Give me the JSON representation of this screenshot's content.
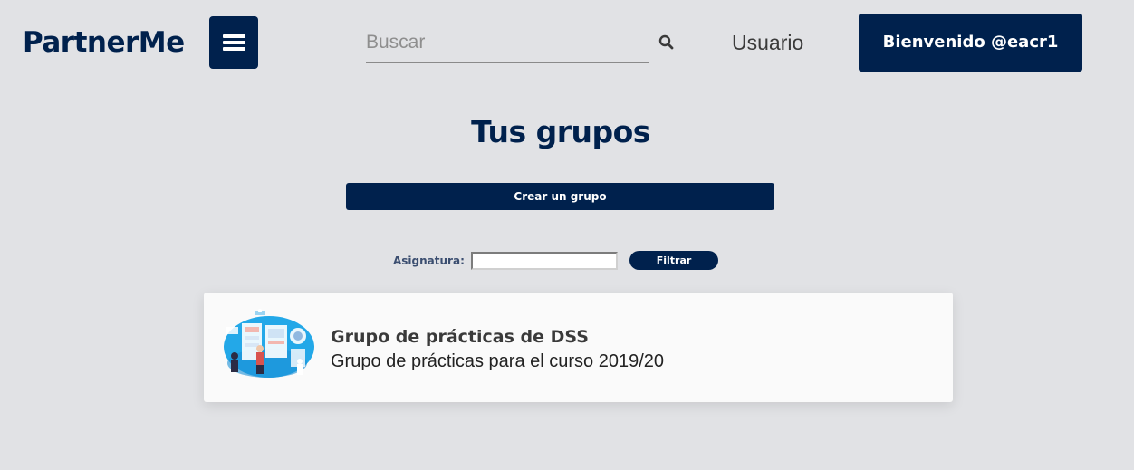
{
  "header": {
    "brand": "PartnerMe",
    "search": {
      "placeholder": "Buscar",
      "value": ""
    },
    "user_link": "Usuario",
    "welcome_button": "Bienvenido @eacr1"
  },
  "main": {
    "title": "Tus grupos",
    "create_button": "Crear un grupo",
    "filter": {
      "label": "Asignatura:",
      "value": "",
      "button": "Filtrar"
    },
    "groups": [
      {
        "name": "Grupo de prácticas de DSS",
        "description": "Grupo de prácticas para el curso 2019/20",
        "image": "team-illustration"
      }
    ]
  },
  "colors": {
    "brand": "#00214d",
    "background": "#e1e2e5",
    "card": "#fafafa"
  }
}
